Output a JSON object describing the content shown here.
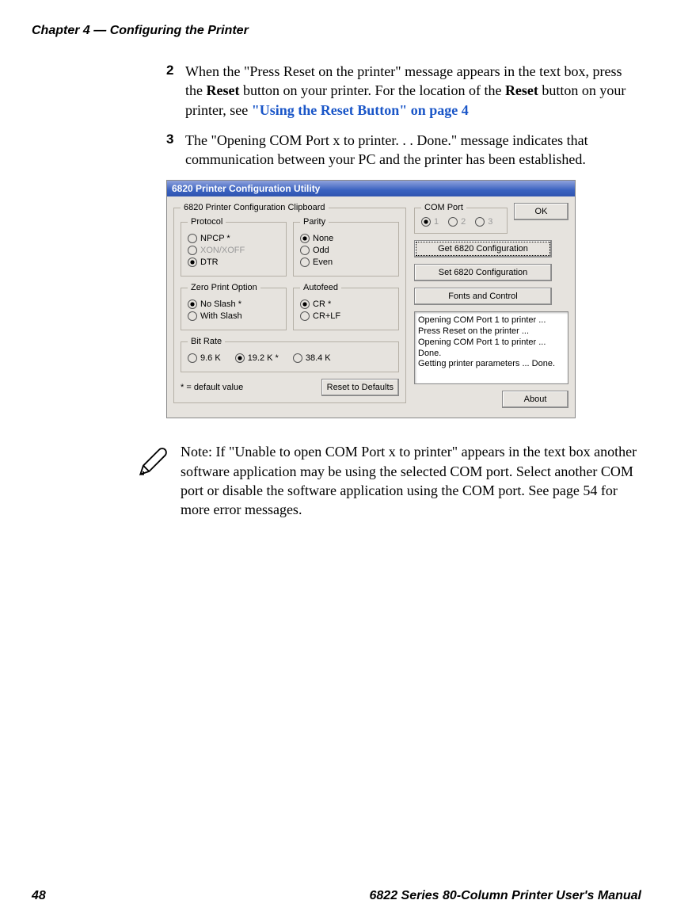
{
  "header": "Chapter 4 — Configuring the Printer",
  "footer_left": "48",
  "footer_right": "6822 Series 80-Column Printer User's Manual",
  "steps": {
    "s2": {
      "num": "2",
      "t1a": "When the \"Press Reset on the printer\" message appears in the text box, press the ",
      "t1b": "Reset",
      "t1c": " button on your printer. For the location of the ",
      "t1d": "Reset",
      "t1e": " button on your printer, see ",
      "link": "\"Using the Reset Button\" on page 4"
    },
    "s3": {
      "num": "3",
      "text": "The \"Opening COM Port x to printer. . . Done.\" message indicates that communication between your PC and the printer has been established."
    }
  },
  "dialog": {
    "title": "6820 Printer Configuration Utility",
    "clipboard_legend": "6820 Printer Configuration Clipboard",
    "protocol_legend": "Protocol",
    "protocol": {
      "npcp": "NPCP *",
      "xon": "XON/XOFF",
      "dtr": "DTR"
    },
    "parity_legend": "Parity",
    "parity": {
      "none": "None",
      "odd": "Odd",
      "even": "Even"
    },
    "zero_legend": "Zero Print Option",
    "zero": {
      "noslash": "No Slash *",
      "withslash": "With Slash"
    },
    "autofeed_legend": "Autofeed",
    "autofeed": {
      "cr": "CR *",
      "crlf": "CR+LF"
    },
    "bitrate_legend": "Bit Rate",
    "bitrate": {
      "a": "9.6 K",
      "b": "19.2 K *",
      "c": "38.4 K"
    },
    "default_note": "* = default value",
    "reset_defaults": "Reset to Defaults",
    "comport_legend": "COM Port",
    "comport": {
      "p1": "1",
      "p2": "2",
      "p3": "3"
    },
    "ok": "OK",
    "get": "Get 6820 Configuration",
    "set": "Set 6820 Configuration",
    "fonts": "Fonts and Control",
    "about": "About",
    "messages": "Opening COM Port 1 to printer ...\n Press Reset on the printer ...\nOpening COM Port 1 to printer ... Done.\nGetting printer parameters ... Done."
  },
  "note": "Note: If \"Unable to open COM Port x to printer\" appears in the text box another software application may be using the selected COM port. Select another COM port or disable the software application using the COM port. See page 54 for more error messages."
}
